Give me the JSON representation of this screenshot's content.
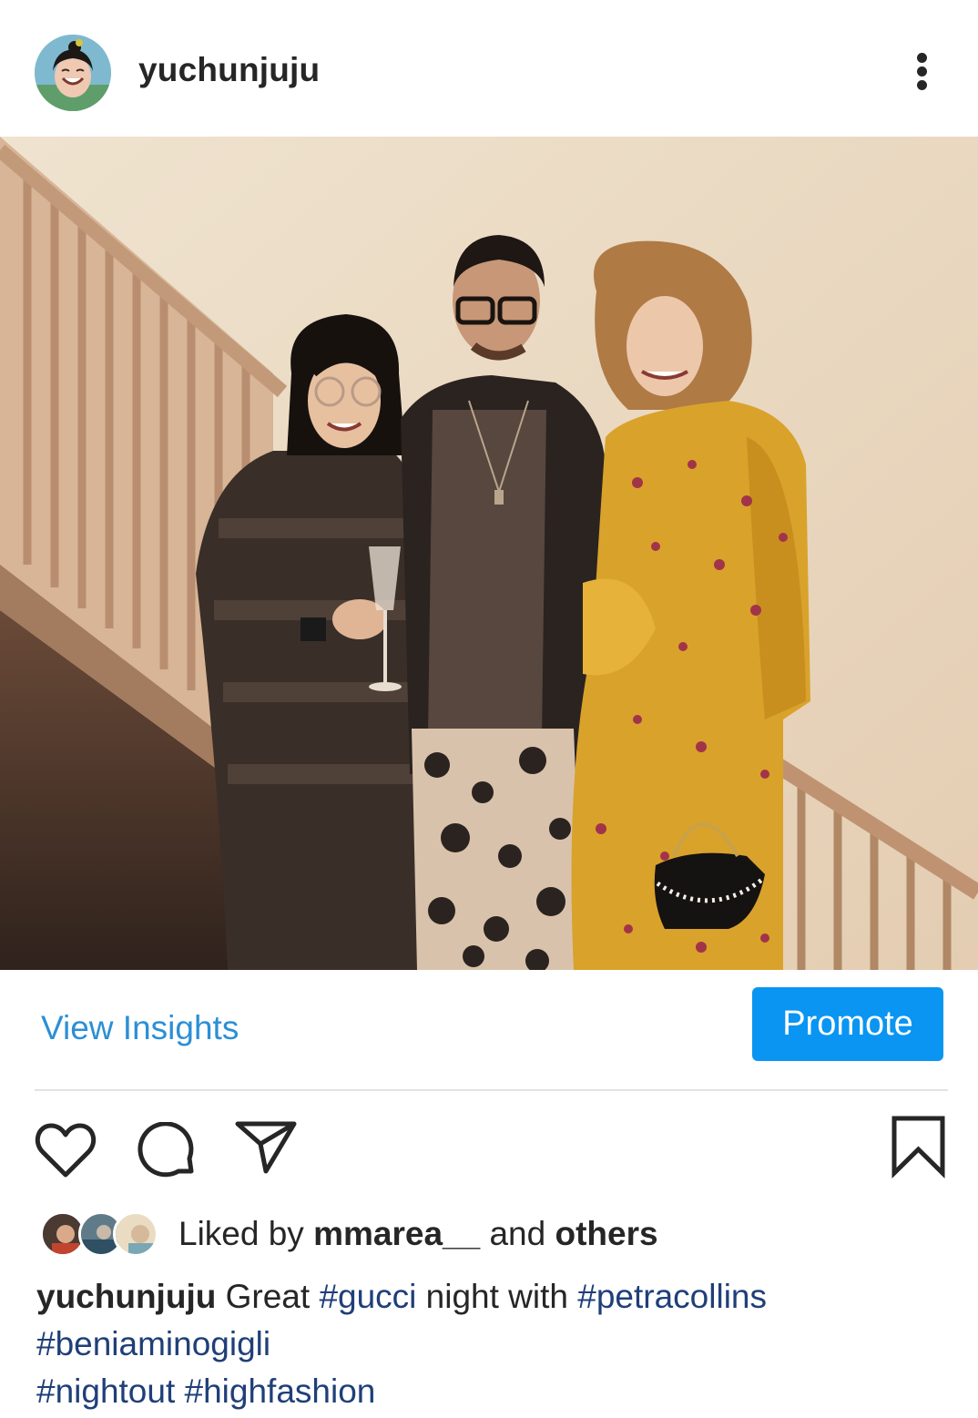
{
  "header": {
    "username": "yuchunjuju",
    "avatar_icon": "profile-avatar",
    "more_icon": "vertical-ellipsis-icon"
  },
  "post": {
    "photo_description_icon": "post-photo"
  },
  "insights": {
    "view_insights_label": "View Insights",
    "promote_label": "Promote"
  },
  "actions": {
    "like_icon": "heart-icon",
    "comment_icon": "comment-bubble-icon",
    "share_icon": "paper-plane-icon",
    "save_icon": "bookmark-icon"
  },
  "likes": {
    "prefix": "Liked by",
    "user": "mmarea__",
    "middle": "and",
    "others": "others"
  },
  "caption": {
    "username": "yuchunjuju",
    "text1": "Great",
    "tag1": "#gucci",
    "text2": "night with",
    "tag2": "#petracollins",
    "tag3": "#beniaminogigli",
    "tag4": "#nightout",
    "tag5": "#highfashion"
  },
  "colors": {
    "link_blue": "#2b8fd6",
    "promote_blue": "#0a95f2",
    "hashtag_blue": "#1f3f78",
    "text_dark": "#262626"
  }
}
